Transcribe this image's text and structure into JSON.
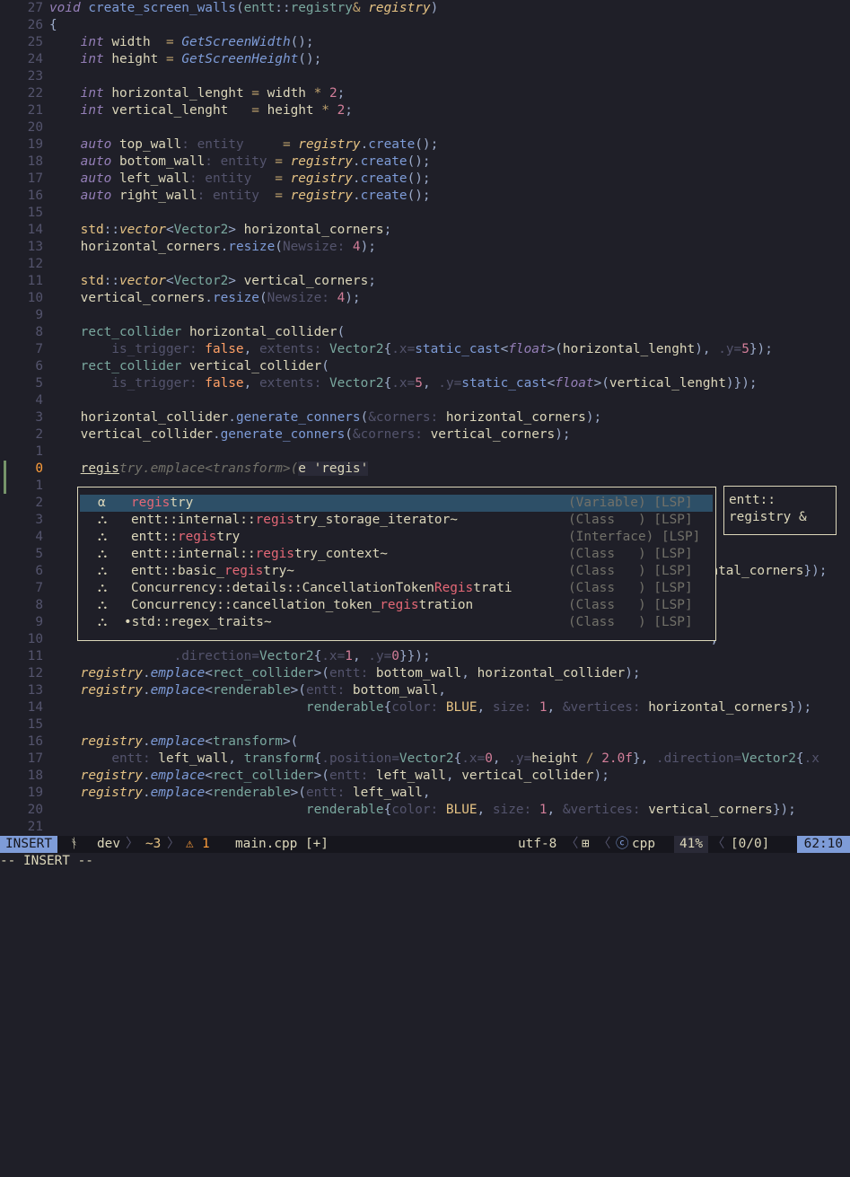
{
  "editor": {
    "lines": [
      {
        "n": "27",
        "html": "<span class='kw'>void</span> <span class='fn'>create_screen_walls</span><span class='punc'>(</span><span class='ty'>entt</span><span class='punc'>::</span><span class='ty'>registry</span><span class='op'>&amp;</span> <span class='reg'>registry</span><span class='punc'>)</span>"
      },
      {
        "n": "26",
        "html": "<span class='punc'>{</span>"
      },
      {
        "n": "25",
        "html": "    <span class='kw'>int</span> width  <span class='op'>=</span> <span class='fni'>GetScreenWidth</span><span class='punc'>();</span>"
      },
      {
        "n": "24",
        "html": "    <span class='kw'>int</span> height <span class='op'>=</span> <span class='fni'>GetScreenHeight</span><span class='punc'>();</span>"
      },
      {
        "n": "23",
        "html": ""
      },
      {
        "n": "22",
        "html": "    <span class='kw'>int</span> horizontal_lenght <span class='op'>=</span> width <span class='op'>*</span> <span class='num'>2</span><span class='punc'>;</span>"
      },
      {
        "n": "21",
        "html": "    <span class='kw'>int</span> vertical_lenght   <span class='op'>=</span> height <span class='op'>*</span> <span class='num'>2</span><span class='punc'>;</span>"
      },
      {
        "n": "20",
        "html": ""
      },
      {
        "n": "19",
        "html": "    <span class='kw'>auto</span> top_wall<span class='hint'>: entity    </span> <span class='op'>=</span> <span class='reg'>registry</span><span class='punc'>.</span><span class='fn'>create</span><span class='punc'>();</span>"
      },
      {
        "n": "18",
        "html": "    <span class='kw'>auto</span> bottom_wall<span class='hint'>: entity</span> <span class='op'>=</span> <span class='reg'>registry</span><span class='punc'>.</span><span class='fn'>create</span><span class='punc'>();</span>"
      },
      {
        "n": "17",
        "html": "    <span class='kw'>auto</span> left_wall<span class='hint'>: entity  </span> <span class='op'>=</span> <span class='reg'>registry</span><span class='punc'>.</span><span class='fn'>create</span><span class='punc'>();</span>"
      },
      {
        "n": "16",
        "html": "    <span class='kw'>auto</span> right_wall<span class='hint'>: entity </span> <span class='op'>=</span> <span class='reg'>registry</span><span class='punc'>.</span><span class='fn'>create</span><span class='punc'>();</span>"
      },
      {
        "n": "15",
        "html": ""
      },
      {
        "n": "14",
        "html": "    <span class='ns'>std</span><span class='punc'>::</span><span class='ty' style='font-style:italic;color:#e6c384'>vector</span><span class='punc'>&lt;</span><span class='ty'>Vector2</span><span class='punc'>&gt;</span> horizontal_corners<span class='punc'>;</span>"
      },
      {
        "n": "13",
        "html": "    horizontal_corners<span class='punc'>.</span><span class='fn'>resize</span><span class='punc'>(</span><span class='hint'>Newsize: </span><span class='num'>4</span><span class='punc'>);</span>"
      },
      {
        "n": "12",
        "html": ""
      },
      {
        "n": "11",
        "html": "    <span class='ns'>std</span><span class='punc'>::</span><span class='ty' style='font-style:italic;color:#e6c384'>vector</span><span class='punc'>&lt;</span><span class='ty'>Vector2</span><span class='punc'>&gt;</span> vertical_corners<span class='punc'>;</span>"
      },
      {
        "n": "10",
        "html": "    vertical_corners<span class='punc'>.</span><span class='fn'>resize</span><span class='punc'>(</span><span class='hint'>Newsize: </span><span class='num'>4</span><span class='punc'>);</span>"
      },
      {
        "n": "9",
        "html": ""
      },
      {
        "n": "8",
        "html": "    <span class='ty'>rect_collider</span> horizontal_collider<span class='punc'>(</span>"
      },
      {
        "n": "7",
        "html": "        <span class='hint'>is_trigger: </span><span class='bool'>false</span><span class='punc'>,</span> <span class='hint'>extents: </span><span class='ty'>Vector2</span><span class='punc'>{</span><span class='hint'>.x=</span><span class='fn'>static_cast</span><span class='punc'>&lt;</span><span class='kw'>float</span><span class='punc'>&gt;(</span>horizontal_lenght<span class='punc'>),</span> <span class='hint'>.y=</span><span class='num'>5</span><span class='punc'>});</span>"
      },
      {
        "n": "6",
        "html": "    <span class='ty'>rect_collider</span> vertical_collider<span class='punc'>(</span>"
      },
      {
        "n": "5",
        "html": "        <span class='hint'>is_trigger: </span><span class='bool'>false</span><span class='punc'>,</span> <span class='hint'>extents: </span><span class='ty'>Vector2</span><span class='punc'>{</span><span class='hint'>.x=</span><span class='num'>5</span><span class='punc'>,</span> <span class='hint'>.y=</span><span class='fn'>static_cast</span><span class='punc'>&lt;</span><span class='kw'>float</span><span class='punc'>&gt;(</span>vertical_lenght<span class='punc'>)});</span>"
      },
      {
        "n": "4",
        "html": ""
      },
      {
        "n": "3",
        "html": "    horizontal_collider<span class='punc'>.</span><span class='fn'>generate_conners</span><span class='punc'>(</span><span class='hint'>&amp;corners: </span>horizontal_corners<span class='punc'>);</span>"
      },
      {
        "n": "2",
        "html": "    vertical_collider<span class='punc'>.</span><span class='fn'>generate_conners</span><span class='punc'>(</span><span class='hint'>&amp;corners: </span>vertical_corners<span class='punc'>);</span>"
      },
      {
        "n": "1",
        "html": ""
      },
      {
        "n": "0",
        "html": "    <span class='under'>regis</span><span class='ghost'>try.emplace&lt;transform&gt;(</span><span style='background:#2a2a37;color:#dcd7ba'>e 'regis'</span>",
        "cur": true
      },
      {
        "n": "1",
        "html": ""
      },
      {
        "n": "2",
        "html": ""
      },
      {
        "n": "3",
        "html": ""
      },
      {
        "n": "4",
        "html": ""
      },
      {
        "n": "5",
        "html": ""
      },
      {
        "n": "6",
        "html": "                                                                                     <span class='var'>ntal_corners</span><span class='punc'>});</span>"
      },
      {
        "n": "7",
        "html": ""
      },
      {
        "n": "8",
        "html": ""
      },
      {
        "n": "9",
        "html": ""
      },
      {
        "n": "10",
        "html": "                                                                                     <span class='punc'>,</span>"
      },
      {
        "n": "11",
        "html": "                <span class='hint'>.direction=</span><span class='ty'>Vector2</span><span class='punc'>{</span><span class='hint'>.x=</span><span class='num'>1</span><span class='punc'>,</span> <span class='hint'>.y=</span><span class='num'>0</span><span class='punc'>}});</span>"
      },
      {
        "n": "12",
        "html": "    <span class='reg'>registry</span><span class='punc'>.</span><span class='fni'>emplace</span><span class='punc'>&lt;</span><span class='ty'>rect_collider</span><span class='punc'>&gt;(</span><span class='hint'>entt: </span>bottom_wall<span class='punc'>,</span> horizontal_collider<span class='punc'>);</span>"
      },
      {
        "n": "13",
        "html": "    <span class='reg'>registry</span><span class='punc'>.</span><span class='fni'>emplace</span><span class='punc'>&lt;</span><span class='ty'>renderable</span><span class='punc'>&gt;(</span><span class='hint'>entt: </span>bottom_wall<span class='punc'>,</span>"
      },
      {
        "n": "14",
        "html": "                                 <span class='ty'>renderable</span><span class='punc'>{</span><span class='hint'>color: </span><span class='mem'>BLUE</span><span class='punc'>,</span> <span class='hint'>size: </span><span class='num'>1</span><span class='punc'>,</span> <span class='hint'>&amp;vertices: </span>horizontal_corners<span class='punc'>});</span>"
      },
      {
        "n": "15",
        "html": ""
      },
      {
        "n": "16",
        "html": "    <span class='reg'>registry</span><span class='punc'>.</span><span class='fni'>emplace</span><span class='punc'>&lt;</span><span class='ty'>transform</span><span class='punc'>&gt;(</span>"
      },
      {
        "n": "17",
        "html": "        <span class='hint'>entt: </span>left_wall<span class='punc'>,</span> <span class='ty'>transform</span><span class='punc'>{</span><span class='hint'>.position=</span><span class='ty'>Vector2</span><span class='punc'>{</span><span class='hint'>.x=</span><span class='num'>0</span><span class='punc'>,</span> <span class='hint'>.y=</span>height <span class='op'>/</span> <span class='num'>2.0f</span><span class='punc'>},</span> <span class='hint'>.direction=</span><span class='ty'>Vector2</span><span class='punc'>{</span><span class='hint'>.x</span>"
      },
      {
        "n": "18",
        "html": "    <span class='reg'>registry</span><span class='punc'>.</span><span class='fni'>emplace</span><span class='punc'>&lt;</span><span class='ty'>rect_collider</span><span class='punc'>&gt;(</span><span class='hint'>entt: </span>left_wall<span class='punc'>,</span> vertical_collider<span class='punc'>);</span>"
      },
      {
        "n": "19",
        "html": "    <span class='reg'>registry</span><span class='punc'>.</span><span class='fni'>emplace</span><span class='punc'>&lt;</span><span class='ty'>renderable</span><span class='punc'>&gt;(</span><span class='hint'>entt: </span>left_wall<span class='punc'>,</span>"
      },
      {
        "n": "20",
        "html": "                                 <span class='ty'>renderable</span><span class='punc'>{</span><span class='hint'>color: </span><span class='mem'>BLUE</span><span class='punc'>,</span> <span class='hint'>size: </span><span class='num'>1</span><span class='punc'>,</span> <span class='hint'>&amp;vertices: </span>vertical_corners<span class='punc'>});</span>"
      },
      {
        "n": "21",
        "html": ""
      }
    ]
  },
  "completion": {
    "items": [
      {
        "icon": "α",
        "icon_name": "variable-icon",
        "label": "<span class='match'>regis</span>try",
        "kind": "(Variable) [LSP]",
        "selected": true
      },
      {
        "icon": "⛬",
        "icon_name": "class-icon",
        "label": "entt::internal::<span class='match'>regis</span>try_storage_iterator~",
        "kind": "(Class   ) [LSP]"
      },
      {
        "icon": "⛬",
        "icon_name": "interface-icon",
        "label": "entt::<span class='match'>regis</span>try",
        "kind": "(Interface) [LSP]"
      },
      {
        "icon": "⛬",
        "icon_name": "class-icon",
        "label": "entt::internal::<span class='match'>regis</span>try_context~",
        "kind": "(Class   ) [LSP]"
      },
      {
        "icon": "⛬",
        "icon_name": "class-icon",
        "label": "entt::basic_<span class='match'>regis</span>try~",
        "kind": "(Class   ) [LSP]"
      },
      {
        "icon": "⛬",
        "icon_name": "class-icon",
        "label": "Concurrency::details::CancellationToken<span class='match'>Regis</span>trati",
        "kind": "(Class   ) [LSP]"
      },
      {
        "icon": "⛬",
        "icon_name": "class-icon",
        "label": "Concurrency::cancellation_token_<span class='match'>regis</span>tration",
        "kind": "(Class   ) [LSP]"
      },
      {
        "icon": "⛬",
        "icon_name": "class-icon",
        "label": "•std::regex_traits~",
        "kind": "(Class   ) [LSP]",
        "dot": true
      }
    ],
    "doc_text": "entt::\nregistry &"
  },
  "statusline": {
    "mode": "INSERT",
    "branch_icon": "ᚬ",
    "branch": "dev",
    "changes": "~3",
    "warn_icon": "⚠",
    "warnings": "1",
    "filename": "main.cpp [+]",
    "encoding": "utf-8",
    "os_icon": "⊞",
    "ft_icon": "ⓒ",
    "filetype": "cpp",
    "percent": "41%",
    "search": "[0/0]",
    "position": "62:10"
  },
  "cmdline": "-- INSERT --",
  "colors": {
    "background": "#1f1f28",
    "mode_bg": "#7e9cd8",
    "selection_bg": "#2d4f67",
    "match": "#e46876"
  }
}
